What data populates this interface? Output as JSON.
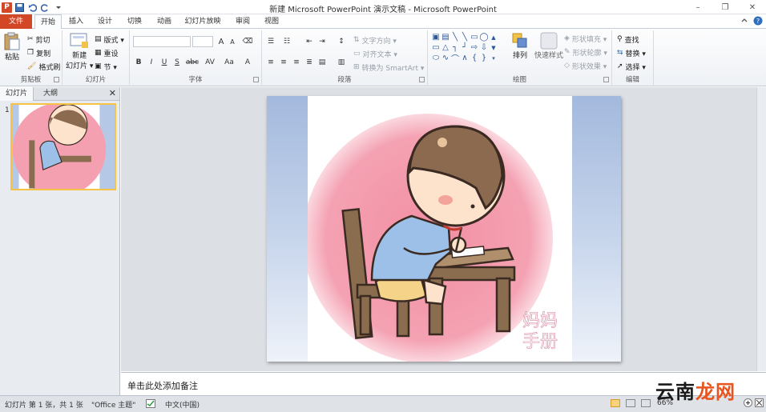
{
  "window": {
    "title": "新建 Microsoft PowerPoint 演示文稿 - Microsoft PowerPoint",
    "minimize": "–",
    "restore": "❐",
    "close": "✕"
  },
  "qat": {
    "logo": "P"
  },
  "tabs": [
    "文件",
    "开始",
    "插入",
    "设计",
    "切换",
    "动画",
    "幻灯片放映",
    "审阅",
    "视图"
  ],
  "ribbon": {
    "clipboard": {
      "paste": "粘贴",
      "cut": "剪切",
      "copy": "复制",
      "format_painter": "格式刷",
      "label": "剪贴板"
    },
    "slides": {
      "new_slide_1": "新建",
      "new_slide_2": "幻灯片 ▾",
      "layout": "版式 ▾",
      "reset": "重设",
      "section": "节 ▾",
      "label": "幻灯片"
    },
    "font": {
      "bold": "B",
      "italic": "I",
      "underline": "U",
      "strike": "S",
      "shadow": "abc",
      "spacing": "AV",
      "case": "Aa",
      "color": "A",
      "grow": "A",
      "shrink": "A",
      "label": "字体"
    },
    "paragraph": {
      "text_direction": "文字方向 ▾",
      "align_text": "对齐文本 ▾",
      "smartart": "转换为 SmartArt ▾",
      "label": "段落"
    },
    "drawing": {
      "arrange": "排列",
      "quick_styles": "快速样式",
      "fill": "形状填充 ▾",
      "outline": "形状轮廓 ▾",
      "effects": "形状效果 ▾",
      "label": "绘图"
    },
    "editing": {
      "find": "查找",
      "replace": "替换 ▾",
      "select": "选择 ▾",
      "label": "编辑"
    }
  },
  "left_panel": {
    "tab_slides": "幻灯片",
    "tab_outline": "大纲",
    "close": "✕",
    "slide_number": "1"
  },
  "notes": {
    "placeholder": "单击此处添加备注"
  },
  "status": {
    "slide_info": "幻灯片 第 1 张，共 1 张",
    "theme": "\"Office 主题\"",
    "language": "中文(中国)",
    "zoom": "66%"
  },
  "slide_watermark": {
    "line1": "妈妈",
    "line2": "手册"
  },
  "site_watermark": {
    "part1": "云南",
    "part2": "龙网"
  },
  "colors": {
    "file_tab": "#d24726",
    "slide_bg_top": "#a3b9dd",
    "pink_circle": "#f4a0b1",
    "shirt": "#9dc0e8",
    "hair": "#8b6a4f",
    "chair": "#8a6d4e"
  }
}
